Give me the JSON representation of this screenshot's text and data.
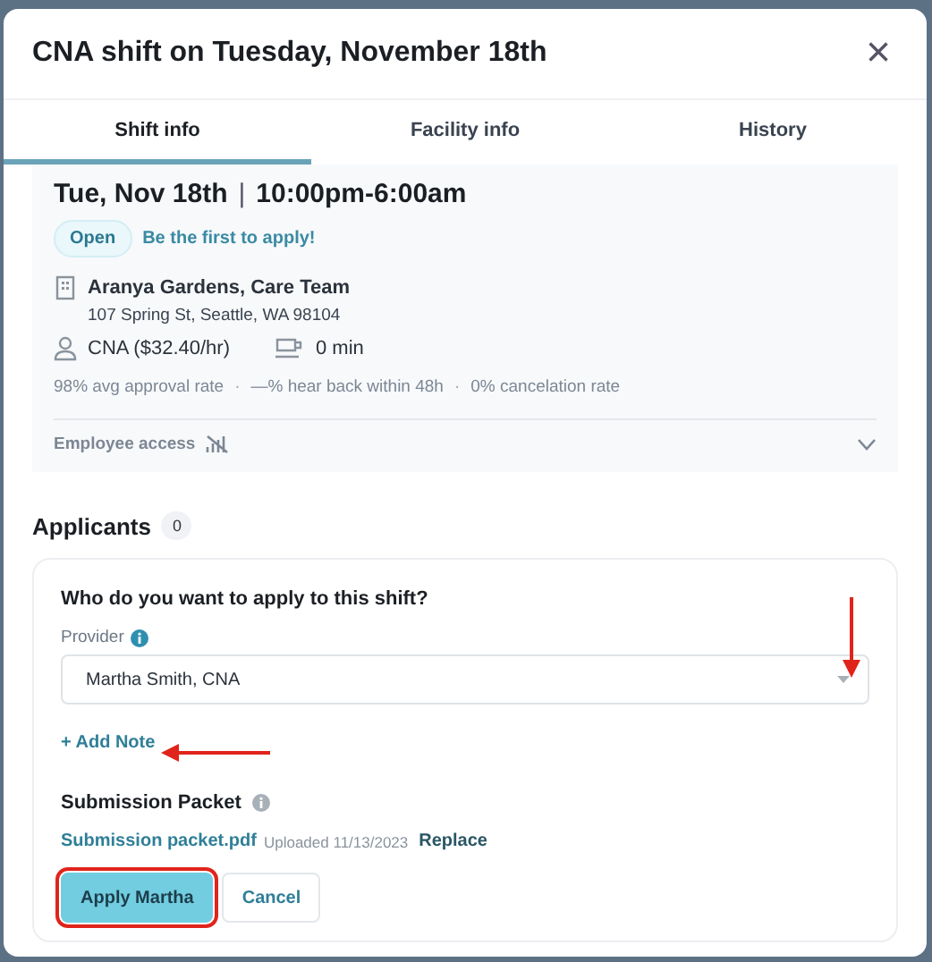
{
  "modal": {
    "title": "CNA shift on Tuesday, November 18th",
    "close": "×"
  },
  "tabs": [
    {
      "label": "Shift info",
      "selected": true
    },
    {
      "label": "Facility info",
      "selected": false
    },
    {
      "label": "History",
      "selected": false
    }
  ],
  "shift": {
    "date": "Tue, Nov 18th",
    "separator": "|",
    "time": "10:00pm-6:00am",
    "status": "Open",
    "status_note": "Be the first to apply!",
    "facility": "Aranya Gardens, Care Team",
    "address": "107 Spring St, Seattle, WA 98104",
    "role": "CNA ($32.40/hr)",
    "break": "0 min",
    "stats": [
      "98% avg approval rate",
      "—% hear back within 48h",
      "0% cancelation rate"
    ],
    "stats_separator": "·",
    "employee_access": {
      "label": "Employee access",
      "expanded": false
    }
  },
  "applicants": {
    "title": "Applicants",
    "count": "0"
  },
  "apply_form": {
    "question": "Who do you want to apply to this shift?",
    "provider_label": "Provider",
    "provider_value": "Martha Smith, CNA",
    "add_note": "+ Add Note",
    "packet_title": "Submission Packet",
    "packet_file": "Submission packet.pdf",
    "packet_uploaded": "Uploaded 11/13/2023",
    "replace": "Replace",
    "buttons": [
      {
        "label": "Apply Martha",
        "kind": "primary",
        "highlighted": true
      },
      {
        "label": "Cancel",
        "kind": "secondary",
        "highlighted": false
      }
    ]
  },
  "annotations": [
    {
      "kind": "down-arrow"
    },
    {
      "kind": "left-arrow"
    }
  ]
}
